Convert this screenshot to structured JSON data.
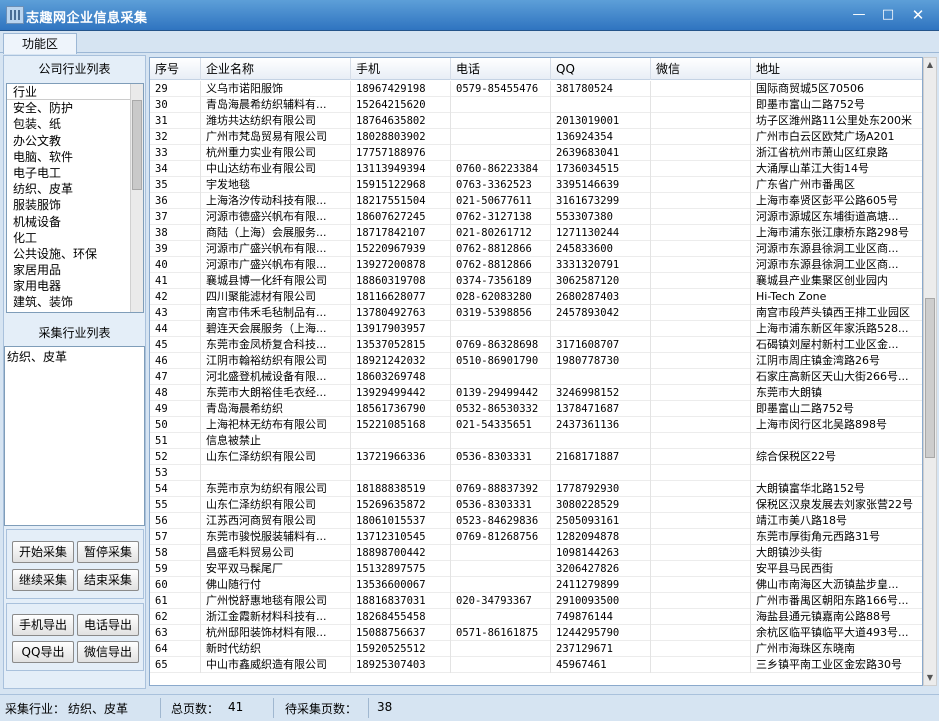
{
  "window": {
    "title": "志趣网企业信息采集",
    "min": "—",
    "max": "□",
    "close": "✕"
  },
  "tabs": [
    {
      "label": "功能区"
    }
  ],
  "left": {
    "industry_list_label": "公司行业列表",
    "industry_header": "行业",
    "industries": [
      "安全、防护",
      "包装、纸",
      "办公文教",
      "电脑、软件",
      "电子电工",
      "纺织、皮革",
      "服装服饰",
      "机械设备",
      "化工",
      "公共设施、环保",
      "家居用品",
      "家用电器",
      "建筑、装饰"
    ],
    "collect_list_label": "采集行业列表",
    "selected_industry": "纺织、皮革",
    "buttons": {
      "start": "开始采集",
      "pause": "暂停采集",
      "resume": "继续采集",
      "stop": "结束采集",
      "export_phone": "手机导出",
      "export_tel": "电话导出",
      "export_qq": "QQ导出",
      "export_wechat": "微信导出"
    }
  },
  "table": {
    "columns": [
      "序号",
      "企业名称",
      "手机",
      "电话",
      "QQ",
      "微信",
      "地址"
    ],
    "rows": [
      [
        "29",
        "义乌市诺阳服饰",
        "18967429198",
        "0579-85455476",
        "381780524",
        "",
        "国际商贸城5区70506"
      ],
      [
        "30",
        "青岛海晨希纺织辅料有...",
        "15264215620",
        "",
        "",
        "",
        "即墨市富山二路752号"
      ],
      [
        "31",
        "潍坊共达纺织有限公司",
        "18764635802",
        "",
        "2013019001",
        "",
        "坊子区潍州路11公里处东200米"
      ],
      [
        "32",
        "广州市梵岛贸易有限公司",
        "18028803902",
        "",
        "136924354",
        "",
        "广州市白云区欧梵广场A201"
      ],
      [
        "33",
        "杭州重力实业有限公司",
        "17757188976",
        "",
        "2639683041",
        "",
        "浙江省杭州市萧山区红泉路"
      ],
      [
        "34",
        "中山达纺布业有限公司",
        "13113949394",
        "0760-86223384",
        "1736034515",
        "",
        "大涌厚山革江大街14号"
      ],
      [
        "35",
        "宇发地毯",
        "15915122968",
        "0763-3362523",
        "3395146639",
        "",
        "广东省广州市番禺区"
      ],
      [
        "36",
        "上海洛汐传动科技有限...",
        "18217551504",
        "021-50677611",
        "3161673299",
        "",
        "上海市奉贤区彭平公路605号"
      ],
      [
        "37",
        "河源市德盛兴帆布有限...",
        "18607627245",
        "0762-3127138",
        "553307380",
        "",
        "河源市源城区东埔街道高塘..."
      ],
      [
        "38",
        "商陆（上海）会展服务...",
        "18717842107",
        "021-80261712",
        "1271130244",
        "",
        "上海市浦东张江康桥东路298号"
      ],
      [
        "39",
        "河源市广盛兴帆布有限...",
        "15220967939",
        "0762-8812866",
        "245833600",
        "",
        "河源市东源县徐洞工业区商..."
      ],
      [
        "40",
        "河源市广盛兴帆布有限...",
        "13927200878",
        "0762-8812866",
        "3331320791",
        "",
        "河源市东源县徐洞工业区商..."
      ],
      [
        "41",
        "襄城县博一化纤有限公司",
        "18860319708",
        "0374-7356189",
        "3062587120",
        "",
        "襄城县产业集聚区创业园内"
      ],
      [
        "42",
        "四川聚能滤材有限公司",
        "18116628077",
        "028-62083280",
        "2680287403",
        "",
        "Hi-Tech Zone"
      ],
      [
        "43",
        "南宫市伟禾毛毡制品有...",
        "13780492763",
        "0319-5398856",
        "2457893042",
        "",
        "南宫市段芦头镇西王排工业园区"
      ],
      [
        "44",
        "碧连天会展服务（上海...",
        "13917903957",
        "",
        "",
        "",
        "上海市浦东新区年家浜路528..."
      ],
      [
        "45",
        "东莞市金凤桥复合科技...",
        "13537052815",
        "0769-86328698",
        "3171608707",
        "",
        "石碣镇刘屋村新村工业区金..."
      ],
      [
        "46",
        "江阴市翰裕纺织有限公司",
        "18921242032",
        "0510-86901790",
        "1980778730",
        "",
        "江阴市周庄镇金湾路26号"
      ],
      [
        "47",
        "河北盛登机械设备有限...",
        "18603269748",
        "",
        "",
        "",
        "石家庄高新区天山大街266号..."
      ],
      [
        "48",
        "东莞市大朗裕佳毛衣经...",
        "13929499442",
        "0139-29499442",
        "3246998152",
        "",
        "东莞市大朗镇"
      ],
      [
        "49",
        "青岛海晨希纺织",
        "18561736790",
        "0532-86530332",
        "1378471687",
        "",
        "即墨富山二路752号"
      ],
      [
        "50",
        "上海祀林无纺布有限公司",
        "15221085168",
        "021-54335651",
        "2437361136",
        "",
        "上海市闵行区北吴路898号"
      ],
      [
        "51",
        "信息被禁止",
        "",
        "",
        "",
        "",
        ""
      ],
      [
        "52",
        "山东仁泽纺织有限公司",
        "13721966336",
        "0536-8303331",
        "2168171887",
        "",
        "综合保税区22号"
      ],
      [
        "53",
        "",
        "",
        "",
        "",
        "",
        ""
      ],
      [
        "54",
        "东莞市京为纺织有限公司",
        "18188838519",
        "0769-88837392",
        "1778792930",
        "",
        "大朗镇富华北路152号"
      ],
      [
        "55",
        "山东仁泽纺织有限公司",
        "15269635872",
        "0536-8303331",
        "3080228529",
        "",
        "保税区汉泉发展去刘家张营22号"
      ],
      [
        "56",
        "江苏西河商贸有限公司",
        "18061015537",
        "0523-84629836",
        "2505093161",
        "",
        "靖江市美八路18号"
      ],
      [
        "57",
        "东莞市骏悦服装辅料有...",
        "13712310545",
        "0769-81268756",
        "1282094878",
        "",
        "东莞市厚街角元西路31号"
      ],
      [
        "58",
        "昌盛毛料贸易公司",
        "18898700442",
        "",
        "1098144263",
        "",
        "大朗镇沙头街"
      ],
      [
        "59",
        "安平双马髹尾厂",
        "15132897575",
        "",
        "3206427826",
        "",
        "安平县马民西街"
      ],
      [
        "60",
        "佛山随行付",
        "13536600067",
        "",
        "2411279899",
        "",
        "佛山市南海区大沥镇盐步皇..."
      ],
      [
        "61",
        "广州悦舒惠地毯有限公司",
        "18816837031",
        "020-34793367",
        "2910093500",
        "",
        "广州市番禺区朝阳东路166号..."
      ],
      [
        "62",
        "浙江金霞新材料科技有...",
        "18268455458",
        "",
        "749876144",
        "",
        "海盐县通元镇嘉南公路88号"
      ],
      [
        "63",
        "杭州邸阳装饰材料有限...",
        "15088756637",
        "0571-86161875",
        "1244295790",
        "",
        "余杭区临平镇临平大道493号..."
      ],
      [
        "64",
        "新时代纺织",
        "15920525512",
        "",
        "237129671",
        "",
        "广州市海珠区东晓南"
      ],
      [
        "65",
        "中山市鑫威织造有限公司",
        "18925307403",
        "",
        "45967461",
        "",
        "三乡镇平南工业区金宏路30号"
      ]
    ]
  },
  "status": {
    "industry_label": "采集行业：",
    "industry_value": "纺织、皮革",
    "total_pages_label": "总页数：",
    "total_pages_value": "41",
    "pending_pages_label": "待采集页数：",
    "pending_pages_value": "38"
  }
}
